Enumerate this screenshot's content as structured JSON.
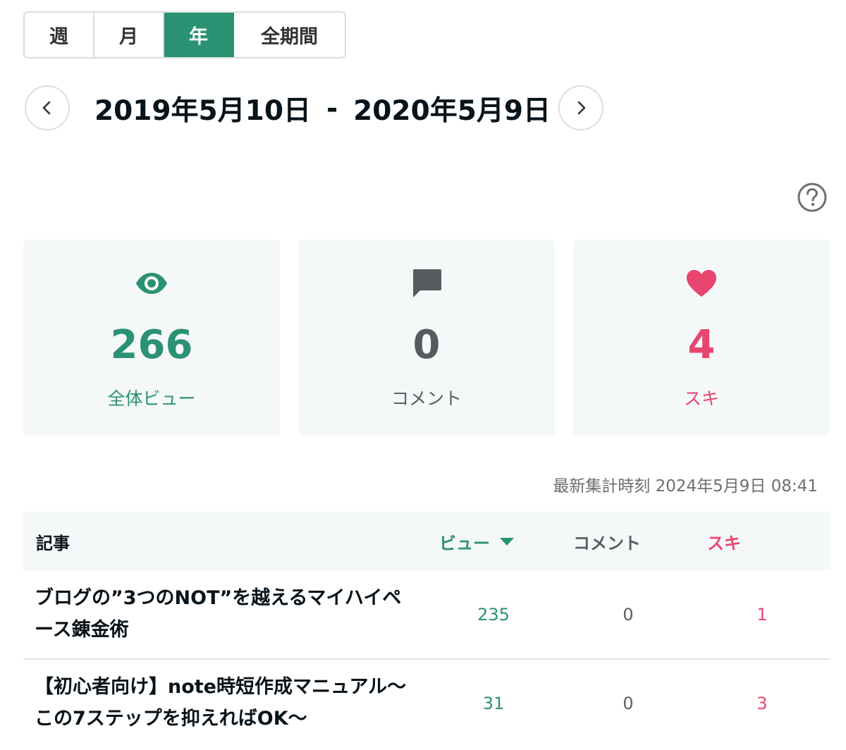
{
  "tabs": [
    {
      "label": "週",
      "active": false
    },
    {
      "label": "月",
      "active": false
    },
    {
      "label": "年",
      "active": true
    },
    {
      "label": "全期間",
      "active": false
    }
  ],
  "date_range": {
    "start": "2019年5月10日",
    "separator": "-",
    "end": "2020年5月9日"
  },
  "icons": {
    "prev": "chevron-left-icon",
    "next": "chevron-right-icon",
    "help": "question-circle-icon",
    "views": "eye-icon",
    "comments": "speech-bubble-icon",
    "likes": "heart-icon"
  },
  "stats": {
    "views": {
      "value": "266",
      "label": "全体ビュー"
    },
    "comments": {
      "value": "0",
      "label": "コメント"
    },
    "likes": {
      "value": "4",
      "label": "スキ"
    }
  },
  "updated": {
    "label": "最新集計時刻",
    "value": "2024年5月9日 08:41"
  },
  "table": {
    "headers": {
      "article": "記事",
      "views": "ビュー",
      "comments": "コメント",
      "likes": "スキ"
    },
    "rows": [
      {
        "title": "ブログの”3つのNOT”を越えるマイハイペース錬金術",
        "views": "235",
        "comments": "0",
        "likes": "1"
      },
      {
        "title": "【初心者向け】note時短作成マニュアル〜この7ステップを抑えればOK〜",
        "views": "31",
        "comments": "0",
        "likes": "3"
      }
    ]
  },
  "colors": {
    "accent_green": "#2a9272",
    "like_pink": "#e8466e",
    "comment_gray": "#5a5f62",
    "card_bg": "#f5f8f9"
  }
}
